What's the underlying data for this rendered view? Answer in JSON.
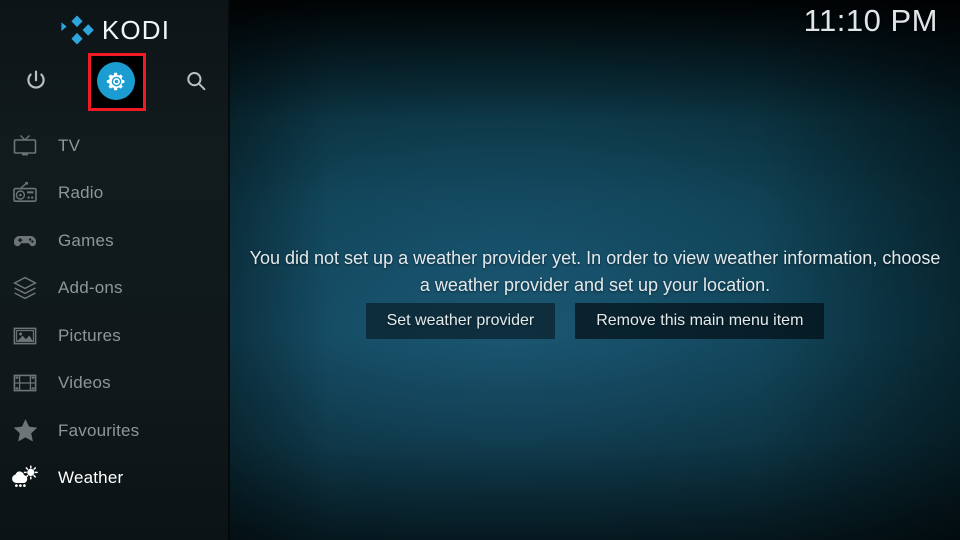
{
  "app": {
    "name": "KODI",
    "logo_icon": "kodi-diamond-logo",
    "accent_color": "#1b9dd1",
    "highlight_color": "#ef1b24"
  },
  "header": {
    "clock": "11:10 PM"
  },
  "sidebar": {
    "top_icons": [
      {
        "name": "power-icon",
        "label": "Power"
      },
      {
        "name": "gear-icon",
        "label": "Settings",
        "selected": true
      },
      {
        "name": "search-icon",
        "label": "Search"
      }
    ],
    "items": [
      {
        "label": "TV",
        "icon": "tv-icon",
        "active": false
      },
      {
        "label": "Radio",
        "icon": "radio-icon",
        "active": false
      },
      {
        "label": "Games",
        "icon": "gamepad-icon",
        "active": false
      },
      {
        "label": "Add-ons",
        "icon": "box-icon",
        "active": false
      },
      {
        "label": "Pictures",
        "icon": "picture-icon",
        "active": false
      },
      {
        "label": "Videos",
        "icon": "film-icon",
        "active": false
      },
      {
        "label": "Favourites",
        "icon": "star-icon",
        "active": false
      },
      {
        "label": "Weather",
        "icon": "weather-cloud-sun-rain-icon",
        "active": true
      }
    ]
  },
  "main": {
    "message": "You did not set up a weather provider yet. In order to view weather information, choose a weather provider and set up your location.",
    "buttons": [
      {
        "label": "Set weather provider"
      },
      {
        "label": "Remove this main menu item"
      }
    ]
  }
}
